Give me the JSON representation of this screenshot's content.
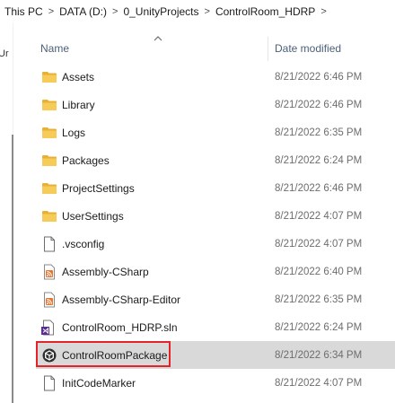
{
  "breadcrumb": {
    "items": [
      "This PC",
      "DATA (D:)",
      "0_UnityProjects",
      "ControlRoom_HDRP"
    ],
    "separator": ">"
  },
  "nav_pane": {
    "stub_text": "Ur"
  },
  "columns": {
    "name": "Name",
    "date_modified": "Date modified"
  },
  "files": [
    {
      "name": "Assets",
      "date": "8/21/2022 6:46 PM",
      "icon": "folder-icon"
    },
    {
      "name": "Library",
      "date": "8/21/2022 6:46 PM",
      "icon": "folder-icon"
    },
    {
      "name": "Logs",
      "date": "8/21/2022 6:35 PM",
      "icon": "folder-icon"
    },
    {
      "name": "Packages",
      "date": "8/21/2022 6:24 PM",
      "icon": "folder-icon"
    },
    {
      "name": "ProjectSettings",
      "date": "8/21/2022 6:46 PM",
      "icon": "folder-icon"
    },
    {
      "name": "UserSettings",
      "date": "8/21/2022 4:07 PM",
      "icon": "folder-icon"
    },
    {
      "name": ".vsconfig",
      "date": "8/21/2022 4:07 PM",
      "icon": "file-icon"
    },
    {
      "name": "Assembly-CSharp",
      "date": "8/21/2022 6:40 PM",
      "icon": "rss-file-icon"
    },
    {
      "name": "Assembly-CSharp-Editor",
      "date": "8/21/2022 6:35 PM",
      "icon": "rss-file-icon"
    },
    {
      "name": "ControlRoom_HDRP.sln",
      "date": "8/21/2022 6:24 PM",
      "icon": "visual-studio-solution-icon"
    },
    {
      "name": "ControlRoomPackage",
      "date": "8/21/2022 6:34 PM",
      "icon": "unity-package-icon",
      "selected": true
    },
    {
      "name": "InitCodeMarker",
      "date": "8/21/2022 4:07 PM",
      "icon": "file-icon"
    }
  ],
  "colors": {
    "selection": "#d9d9d9",
    "highlight_border": "#e2232a",
    "folder": "#f4c54d",
    "header_text": "#4c607a"
  }
}
